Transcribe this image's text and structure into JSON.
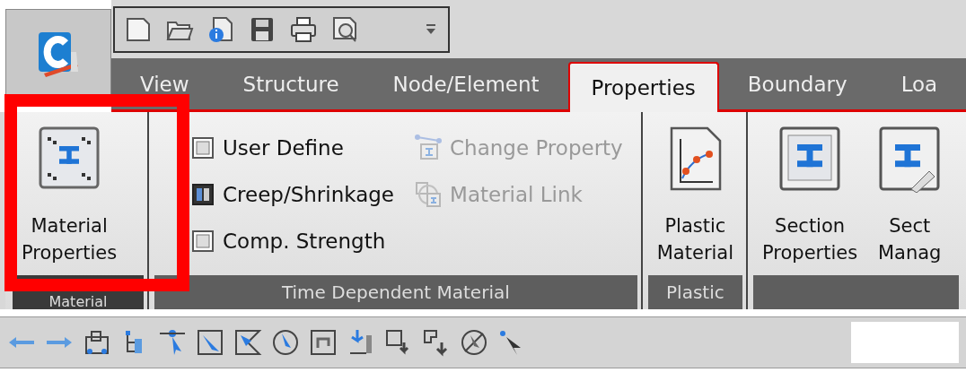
{
  "tabs": [
    {
      "label": "View",
      "selected": false
    },
    {
      "label": "Structure",
      "selected": false
    },
    {
      "label": "Node/Element",
      "selected": false
    },
    {
      "label": "Properties",
      "selected": true
    },
    {
      "label": "Boundary",
      "selected": false
    },
    {
      "label": "Loa",
      "selected": false
    }
  ],
  "groups": [
    {
      "title": "Material",
      "items": [
        {
          "kind": "large",
          "lines": [
            "Material",
            "Properties"
          ]
        }
      ]
    },
    {
      "title": "Time Dependent Material",
      "items": [
        {
          "kind": "small",
          "label": "User Define",
          "disabled": false
        },
        {
          "kind": "small",
          "label": "Creep/Shrinkage",
          "disabled": false
        },
        {
          "kind": "small",
          "label": "Comp. Strength",
          "disabled": false
        },
        {
          "kind": "small",
          "label": "Change Property",
          "disabled": true
        },
        {
          "kind": "small",
          "label": "Material Link",
          "disabled": true
        }
      ]
    },
    {
      "title": "Plastic",
      "items": [
        {
          "kind": "large",
          "lines": [
            "Plastic",
            "Material"
          ]
        }
      ]
    },
    {
      "items": [
        {
          "kind": "large",
          "lines": [
            "Section",
            "Properties"
          ]
        },
        {
          "kind": "large",
          "lines": [
            "Sect",
            "Manag"
          ]
        }
      ]
    }
  ]
}
